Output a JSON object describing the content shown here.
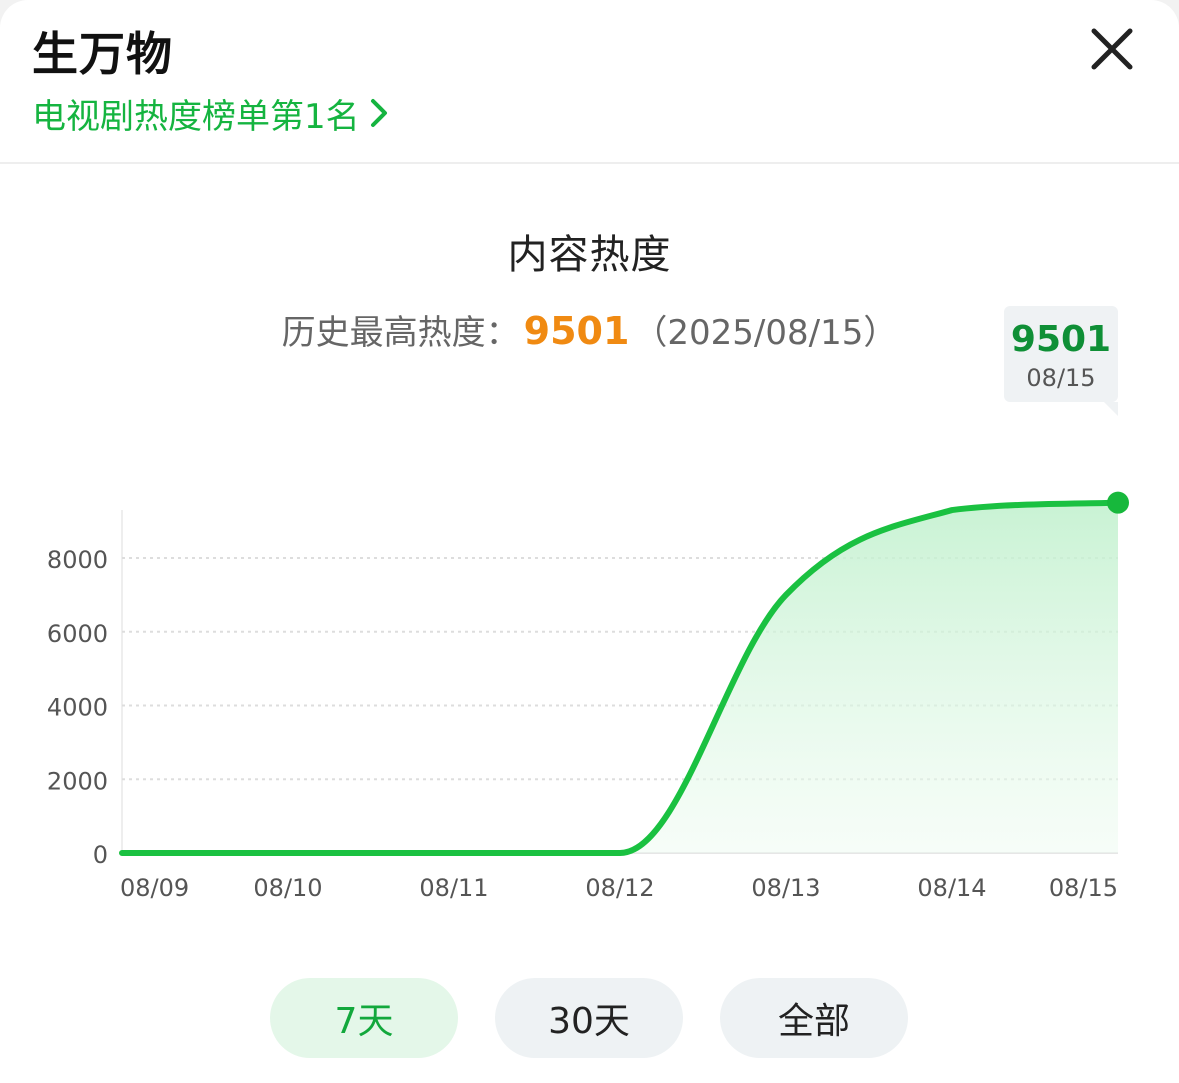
{
  "header": {
    "title": "生万物",
    "rank_link": "电视剧热度榜单第1名"
  },
  "chart_section": {
    "heading": "内容热度",
    "peak_label": "历史最高热度：",
    "peak_value": "9501",
    "peak_date": "（2025/08/15）"
  },
  "tooltip": {
    "value": "9501",
    "date": "08/15"
  },
  "colors": {
    "accent_green": "#15b440",
    "peak_orange": "#f08a12",
    "line_green": "#1ac141"
  },
  "chart_data": {
    "type": "area",
    "title": "内容热度",
    "xlabel": "",
    "ylabel": "",
    "categories": [
      "08/09",
      "08/10",
      "08/11",
      "08/12",
      "08/13",
      "08/14",
      "08/15"
    ],
    "y_ticks": [
      "0",
      "2000",
      "4000",
      "6000",
      "8000"
    ],
    "ylim": [
      0,
      9800
    ],
    "grid": true,
    "series": [
      {
        "x": [
          "08/09",
          "08/10",
          "08/11",
          "08/12",
          "08/13",
          "08/14",
          "08/15"
        ],
        "values": [
          0,
          0,
          0,
          0,
          7000,
          9300,
          9501
        ]
      }
    ]
  },
  "range_tabs": [
    {
      "label": "7天",
      "active": true
    },
    {
      "label": "30天",
      "active": false
    },
    {
      "label": "全部",
      "active": false
    }
  ]
}
